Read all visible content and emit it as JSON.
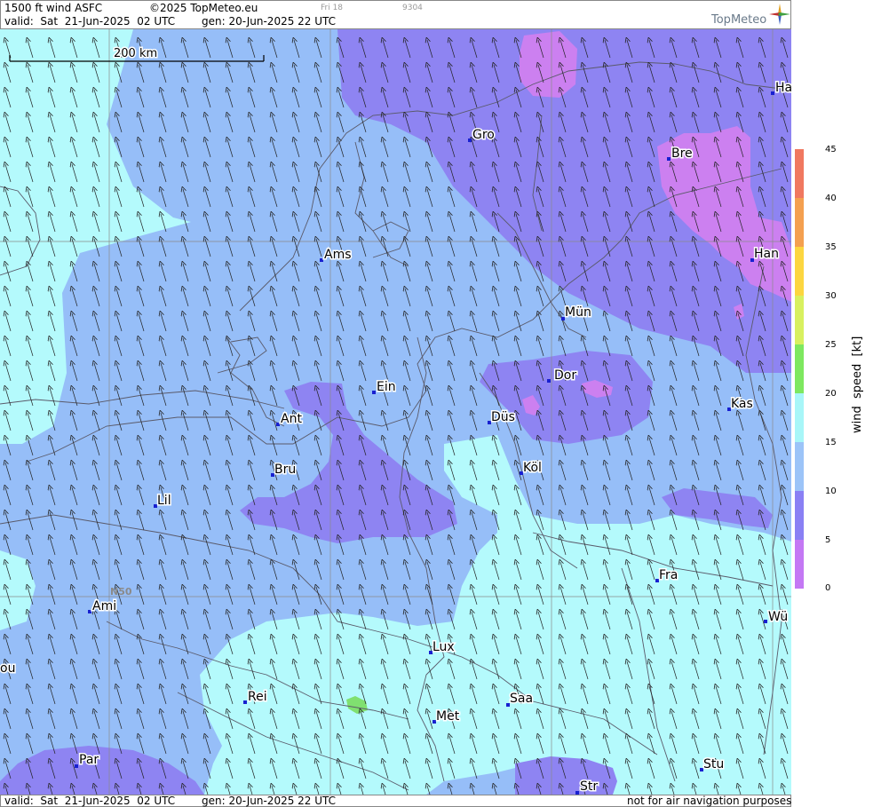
{
  "header": {
    "product": "1500 ft wind ASFC",
    "copyright": "©2025 TopMeteo.eu",
    "day": "Fri 18",
    "code": "9304",
    "valid": "valid:  Sat  21-Jun-2025  02 UTC",
    "gen": "gen: 20-Jun-2025 22 UTC",
    "brand": "TopMeteo"
  },
  "footer": {
    "valid": "valid:  Sat  21-Jun-2025  02 UTC",
    "gen": "gen: 20-Jun-2025 22 UTC",
    "disclaimer": "not for air navigation purposes"
  },
  "map": {
    "scale_label": "200 km",
    "lat_label": "N50",
    "cities": [
      {
        "label": "Gro"
      },
      {
        "label": "Bre"
      },
      {
        "label": "Ha"
      },
      {
        "label": "Ams"
      },
      {
        "label": "Han"
      },
      {
        "label": "Mün"
      },
      {
        "label": "Dor"
      },
      {
        "label": "Ein"
      },
      {
        "label": "Kas"
      },
      {
        "label": "Ant"
      },
      {
        "label": "Düs"
      },
      {
        "label": "Köl"
      },
      {
        "label": "Bru"
      },
      {
        "label": "Lil"
      },
      {
        "label": "Fra"
      },
      {
        "label": "Ami"
      },
      {
        "label": "Wü"
      },
      {
        "label": "Lux"
      },
      {
        "label": "ou"
      },
      {
        "label": "Rei"
      },
      {
        "label": "Saa"
      },
      {
        "label": "Met"
      },
      {
        "label": "Stu"
      },
      {
        "label": "Par"
      },
      {
        "label": "Str"
      }
    ],
    "wind_direction": "from south-east, arrows pointing north-west"
  },
  "legend": {
    "title": "wind  speed  [kt]",
    "ticks": [
      "45",
      "40",
      "35",
      "30",
      "25",
      "20",
      "15",
      "10",
      "5",
      "0"
    ],
    "colors": [
      "#f07860",
      "#f4a050",
      "#fcd640",
      "#d8f060",
      "#7ee860",
      "#a8f6f8",
      "#9cc4f8",
      "#8a80f4",
      "#c478f4"
    ]
  },
  "palette": {
    "cyan": "#b4fafc",
    "light_blue": "#96bef8",
    "blue_purple": "#8e84f2",
    "purple": "#b47af0",
    "violet": "#cc80f0",
    "green": "#80e070"
  }
}
